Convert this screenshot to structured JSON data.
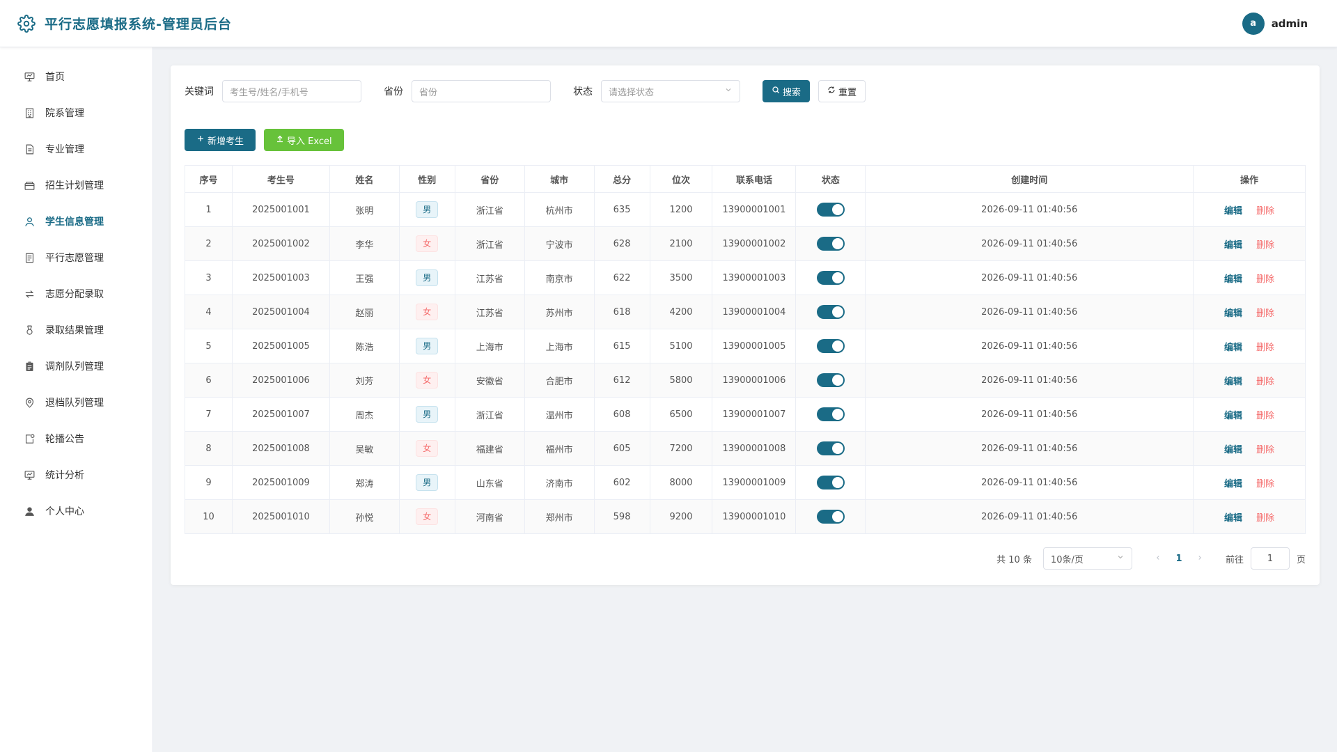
{
  "header": {
    "title": "平行志愿填报系统-管理员后台",
    "avatar_letter": "a",
    "username": "admin"
  },
  "sidebar": {
    "items": [
      {
        "label": "首页",
        "icon": "presentation-icon",
        "active": false
      },
      {
        "label": "院系管理",
        "icon": "building-icon",
        "active": false
      },
      {
        "label": "专业管理",
        "icon": "document-icon",
        "active": false
      },
      {
        "label": "招生计划管理",
        "icon": "briefcase-icon",
        "active": false
      },
      {
        "label": "学生信息管理",
        "icon": "user-icon",
        "active": true
      },
      {
        "label": "平行志愿管理",
        "icon": "list-document-icon",
        "active": false
      },
      {
        "label": "志愿分配录取",
        "icon": "switch-arrows-icon",
        "active": false
      },
      {
        "label": "录取结果管理",
        "icon": "medal-icon",
        "active": false
      },
      {
        "label": "调剂队列管理",
        "icon": "clipboard-icon",
        "active": false
      },
      {
        "label": "退档队列管理",
        "icon": "location-icon",
        "active": false
      },
      {
        "label": "轮播公告",
        "icon": "notice-icon",
        "active": false
      },
      {
        "label": "统计分析",
        "icon": "chart-board-icon",
        "active": false
      },
      {
        "label": "个人中心",
        "icon": "user-filled-icon",
        "active": false
      }
    ]
  },
  "filters": {
    "keyword_label": "关键词",
    "keyword_placeholder": "考生号/姓名/手机号",
    "province_label": "省份",
    "province_placeholder": "省份",
    "status_label": "状态",
    "status_placeholder": "请选择状态",
    "search_label": "搜索",
    "reset_label": "重置"
  },
  "actions": {
    "add_label": "新增考生",
    "import_label": "导入 Excel"
  },
  "table": {
    "columns": [
      "序号",
      "考生号",
      "姓名",
      "性别",
      "省份",
      "城市",
      "总分",
      "位次",
      "联系电话",
      "状态",
      "创建时间",
      "操作"
    ],
    "edit_label": "编辑",
    "delete_label": "删除",
    "rows": [
      {
        "no": "1",
        "id": "2025001001",
        "name": "张明",
        "gender": "男",
        "province": "浙江省",
        "city": "杭州市",
        "score": "635",
        "rank": "1200",
        "phone": "13900001001",
        "status": true,
        "created": "2026-09-11 01:40:56"
      },
      {
        "no": "2",
        "id": "2025001002",
        "name": "李华",
        "gender": "女",
        "province": "浙江省",
        "city": "宁波市",
        "score": "628",
        "rank": "2100",
        "phone": "13900001002",
        "status": true,
        "created": "2026-09-11 01:40:56"
      },
      {
        "no": "3",
        "id": "2025001003",
        "name": "王强",
        "gender": "男",
        "province": "江苏省",
        "city": "南京市",
        "score": "622",
        "rank": "3500",
        "phone": "13900001003",
        "status": true,
        "created": "2026-09-11 01:40:56"
      },
      {
        "no": "4",
        "id": "2025001004",
        "name": "赵丽",
        "gender": "女",
        "province": "江苏省",
        "city": "苏州市",
        "score": "618",
        "rank": "4200",
        "phone": "13900001004",
        "status": true,
        "created": "2026-09-11 01:40:56"
      },
      {
        "no": "5",
        "id": "2025001005",
        "name": "陈浩",
        "gender": "男",
        "province": "上海市",
        "city": "上海市",
        "score": "615",
        "rank": "5100",
        "phone": "13900001005",
        "status": true,
        "created": "2026-09-11 01:40:56"
      },
      {
        "no": "6",
        "id": "2025001006",
        "name": "刘芳",
        "gender": "女",
        "province": "安徽省",
        "city": "合肥市",
        "score": "612",
        "rank": "5800",
        "phone": "13900001006",
        "status": true,
        "created": "2026-09-11 01:40:56"
      },
      {
        "no": "7",
        "id": "2025001007",
        "name": "周杰",
        "gender": "男",
        "province": "浙江省",
        "city": "温州市",
        "score": "608",
        "rank": "6500",
        "phone": "13900001007",
        "status": true,
        "created": "2026-09-11 01:40:56"
      },
      {
        "no": "8",
        "id": "2025001008",
        "name": "吴敏",
        "gender": "女",
        "province": "福建省",
        "city": "福州市",
        "score": "605",
        "rank": "7200",
        "phone": "13900001008",
        "status": true,
        "created": "2026-09-11 01:40:56"
      },
      {
        "no": "9",
        "id": "2025001009",
        "name": "郑涛",
        "gender": "男",
        "province": "山东省",
        "city": "济南市",
        "score": "602",
        "rank": "8000",
        "phone": "13900001009",
        "status": true,
        "created": "2026-09-11 01:40:56"
      },
      {
        "no": "10",
        "id": "2025001010",
        "name": "孙悦",
        "gender": "女",
        "province": "河南省",
        "city": "郑州市",
        "score": "598",
        "rank": "9200",
        "phone": "13900001010",
        "status": true,
        "created": "2026-09-11 01:40:56"
      }
    ]
  },
  "pagination": {
    "total_text": "共 10 条",
    "page_size": "10条/页",
    "current_page": "1",
    "goto_label": "前往",
    "goto_value": "1",
    "page_suffix": "页"
  },
  "colors": {
    "primary": "#1a6b86",
    "success": "#67c23a",
    "danger": "#f56c6c"
  }
}
